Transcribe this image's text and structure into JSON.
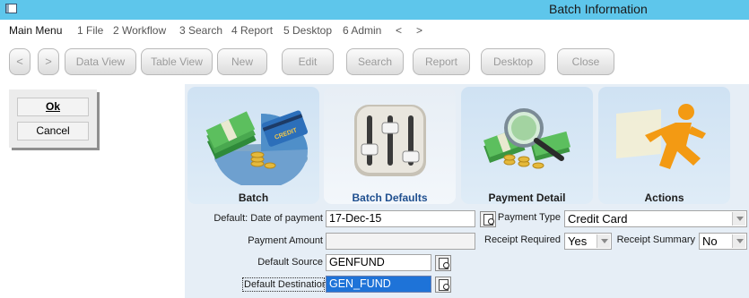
{
  "window": {
    "title": "Batch Information"
  },
  "menubar": {
    "items": [
      "Main Menu",
      "1 File",
      "2 Workflow",
      "3 Search",
      "4 Report",
      "5 Desktop",
      "6 Admin",
      "<",
      ">"
    ]
  },
  "toolbar": {
    "back": "<",
    "forward": ">",
    "buttons": [
      "Data View",
      "Table View",
      "New",
      "Edit",
      "Search",
      "Report",
      "Desktop",
      "Close"
    ]
  },
  "dialog": {
    "ok_label": "Ok",
    "cancel_label": "Cancel"
  },
  "tiles": [
    {
      "label": "Batch",
      "icon": "batch-money-card-icon",
      "card_text": "CREDIT"
    },
    {
      "label": "Batch Defaults",
      "icon": "mixer-sliders-icon"
    },
    {
      "label": "Payment Detail",
      "icon": "magnifier-money-icon"
    },
    {
      "label": "Actions",
      "icon": "running-man-icon"
    }
  ],
  "form": {
    "date_of_payment": {
      "label": "Default: Date of payment",
      "value": "17-Dec-15"
    },
    "payment_amount": {
      "label": "Payment Amount",
      "value": ""
    },
    "default_source": {
      "label": "Default Source",
      "value": "GENFUND"
    },
    "default_destination": {
      "label": "Default Destination",
      "value": "GEN_FUND"
    },
    "payment_type": {
      "label": "Payment Type",
      "value": "Credit Card"
    },
    "receipt_required": {
      "label": "Receipt Required",
      "value": "Yes"
    },
    "receipt_summary": {
      "label": "Receipt Summary",
      "value": "No"
    }
  },
  "colors": {
    "titlebar": "#5ec6eb",
    "content_bg": "#e6eef6",
    "active_tile_label": "#1f4f8f",
    "selection": "#1e73d8"
  }
}
